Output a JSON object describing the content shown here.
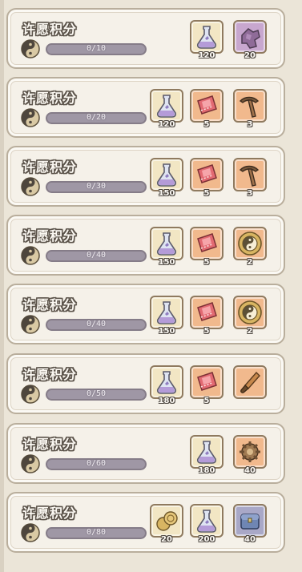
{
  "rows": [
    {
      "title": "许愿积分",
      "progress": "0/10",
      "rewards": [
        {
          "icon": "potion-flask-icon",
          "quantity": "120",
          "bg": "#f2e6c4"
        },
        {
          "icon": "purple-crystal-icon",
          "quantity": "20",
          "bg": "#c8a7cf"
        }
      ]
    },
    {
      "title": "许愿积分",
      "progress": "0/20",
      "rewards": [
        {
          "icon": "potion-flask-icon",
          "quantity": "120",
          "bg": "#f2e6c4"
        },
        {
          "icon": "red-ticket-icon",
          "quantity": "5",
          "bg": "#f1b98d"
        },
        {
          "icon": "pickaxe-icon",
          "quantity": "3",
          "bg": "#f1b98d"
        }
      ]
    },
    {
      "title": "许愿积分",
      "progress": "0/30",
      "rewards": [
        {
          "icon": "potion-flask-icon",
          "quantity": "150",
          "bg": "#f2e6c4"
        },
        {
          "icon": "red-ticket-icon",
          "quantity": "5",
          "bg": "#f1b98d"
        },
        {
          "icon": "pickaxe-icon",
          "quantity": "3",
          "bg": "#f1b98d"
        }
      ]
    },
    {
      "title": "许愿积分",
      "progress": "0/40",
      "rewards": [
        {
          "icon": "potion-flask-icon",
          "quantity": "150",
          "bg": "#f2e6c4"
        },
        {
          "icon": "red-ticket-icon",
          "quantity": "5",
          "bg": "#f1b98d"
        },
        {
          "icon": "yin-yang-coin-icon",
          "quantity": "2",
          "bg": "#f1b98d"
        }
      ]
    },
    {
      "title": "许愿积分",
      "progress": "0/40",
      "rewards": [
        {
          "icon": "potion-flask-icon",
          "quantity": "150",
          "bg": "#f2e6c4"
        },
        {
          "icon": "red-ticket-icon",
          "quantity": "5",
          "bg": "#f1b98d"
        },
        {
          "icon": "yin-yang-coin-icon",
          "quantity": "2",
          "bg": "#f1b98d"
        }
      ]
    },
    {
      "title": "许愿积分",
      "progress": "0/50",
      "rewards": [
        {
          "icon": "potion-flask-icon",
          "quantity": "180",
          "bg": "#f2e6c4"
        },
        {
          "icon": "red-ticket-icon",
          "quantity": "5",
          "bg": "#f1b98d"
        },
        {
          "icon": "brush-icon",
          "quantity": "",
          "bg": "#f1b98d"
        }
      ]
    },
    {
      "title": "许愿积分",
      "progress": "0/60",
      "rewards": [
        {
          "icon": "potion-flask-icon",
          "quantity": "180",
          "bg": "#f2e6c4"
        },
        {
          "icon": "gear-relic-icon",
          "quantity": "40",
          "bg": "#f1b98d"
        }
      ]
    },
    {
      "title": "许愿积分",
      "progress": "0/80",
      "rewards": [
        {
          "icon": "coin-pile-icon",
          "quantity": "20",
          "bg": "#f2e6c4"
        },
        {
          "icon": "potion-flask-icon",
          "quantity": "200",
          "bg": "#f2e6c4"
        },
        {
          "icon": "blue-chest-icon",
          "quantity": "40",
          "bg": "#a9a8c7"
        }
      ]
    }
  ]
}
